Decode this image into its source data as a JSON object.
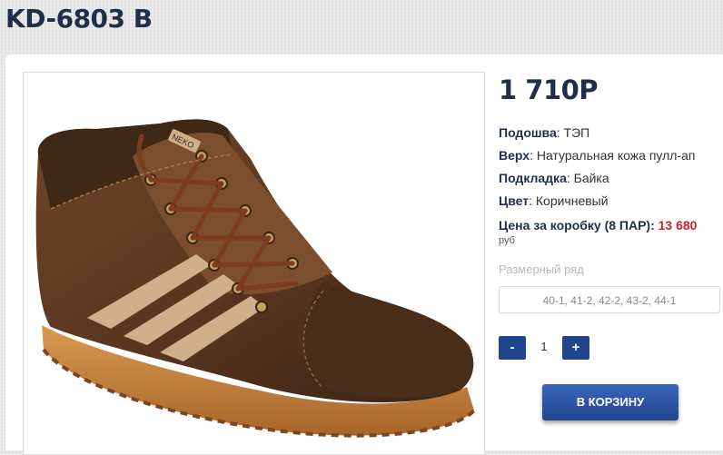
{
  "product": {
    "title": "KD-6803 B",
    "price": "1 710Р",
    "brand_mark": "NEKO",
    "specs": [
      {
        "label": "Подошва",
        "value": ": ТЭП"
      },
      {
        "label": "Верх",
        "value": ": Натуральная кожа пулл-ап"
      },
      {
        "label": "Подкладка",
        "value": ": Байка"
      },
      {
        "label": "Цвет",
        "value": ": Коричневый"
      }
    ],
    "box_price": {
      "label": "Цена за коробку (8 ПАР):",
      "value": "13 680",
      "currency": "руб"
    },
    "size_range": {
      "label": "Размерный ряд",
      "value": "40-1, 41-2, 42-2, 43-2, 44-1"
    },
    "quantity": {
      "minus": "-",
      "value": "1",
      "plus": "+"
    },
    "cart_button": "В КОРЗИНУ"
  },
  "colors": {
    "brand_navy": "#1f2f4a",
    "button_blue": "#20458f",
    "price_red": "#d0202a"
  },
  "icons": {
    "product_image": "brown-leather-sneaker-boot-photo"
  }
}
